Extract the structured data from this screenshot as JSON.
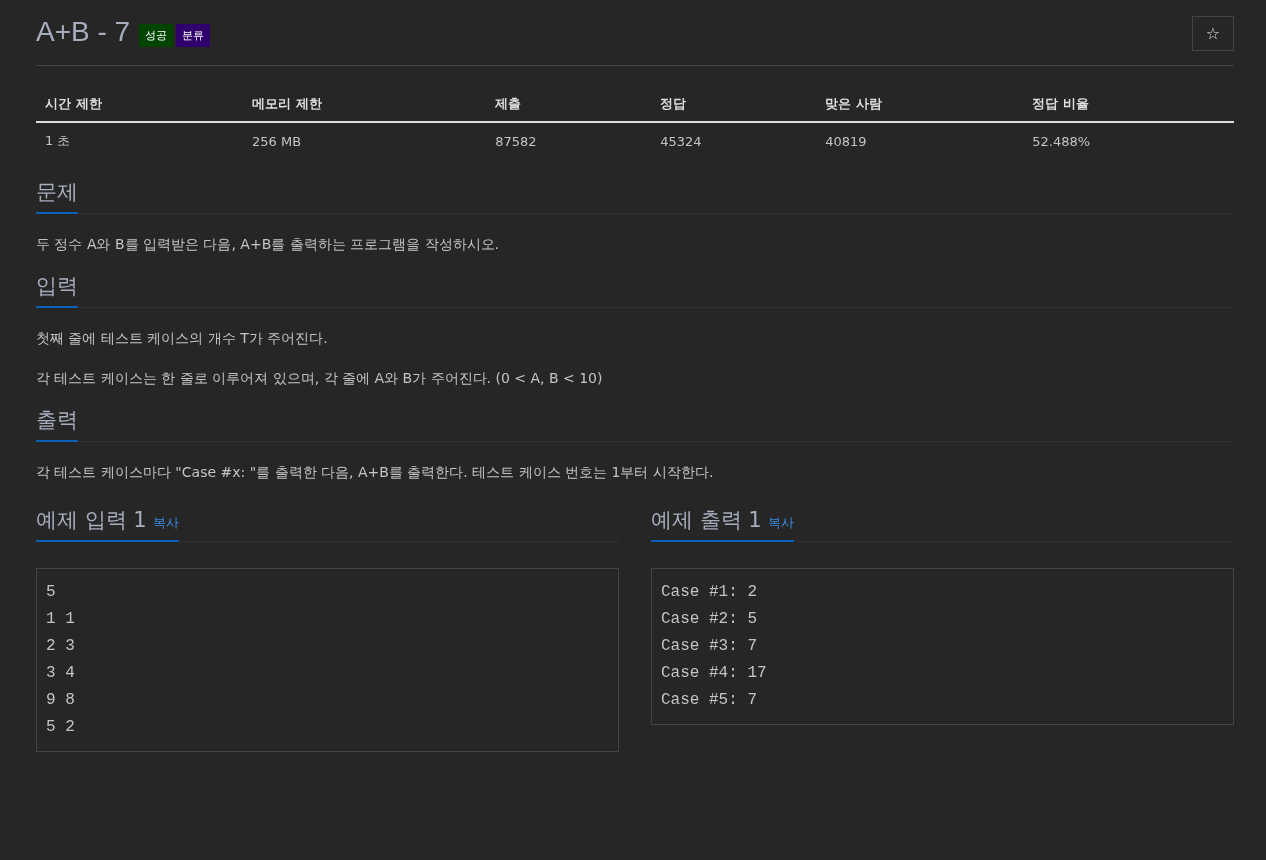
{
  "problem": {
    "title": "A+B - 7",
    "badges": [
      {
        "label": "성공",
        "color": "#004400"
      },
      {
        "label": "분류",
        "color": "#2f006b"
      }
    ],
    "star_button": {
      "label": "☆"
    }
  },
  "stats": {
    "columns": [
      "시간 제한",
      "메모리 제한",
      "제출",
      "정답",
      "맞은 사람",
      "정답 비율"
    ],
    "row": [
      "1 초",
      "256 MB",
      "87582",
      "45324",
      "40819",
      "52.488%"
    ]
  },
  "sections": [
    {
      "heading": "문제",
      "paragraphs": [
        "두 정수 A와 B를 입력받은 다음, A+B를 출력하는 프로그램을 작성하시오."
      ]
    },
    {
      "heading": "입력",
      "paragraphs": [
        "첫째 줄에 테스트 케이스의 개수 T가 주어진다.",
        "각 테스트 케이스는 한 줄로 이루어져 있으며, 각 줄에 A와 B가 주어진다. (0 < A, B < 10)"
      ]
    },
    {
      "heading": "출력",
      "paragraphs": [
        "각 테스트 케이스마다 \"Case #x: \"를 출력한 다음, A+B를 출력한다. 테스트 케이스 번호는 1부터 시작한다."
      ]
    }
  ],
  "samples": [
    {
      "heading": "예제 입력 1",
      "copy": "복사",
      "lines": [
        "5",
        "1 1",
        "2 3",
        "3 4",
        "9 8",
        "5 2"
      ]
    },
    {
      "heading": "예제 출력 1",
      "copy": "복사",
      "lines": [
        "Case #1: 2",
        "Case #2: 5",
        "Case #3: 7",
        "Case #4: 17",
        "Case #5: 7"
      ]
    }
  ]
}
